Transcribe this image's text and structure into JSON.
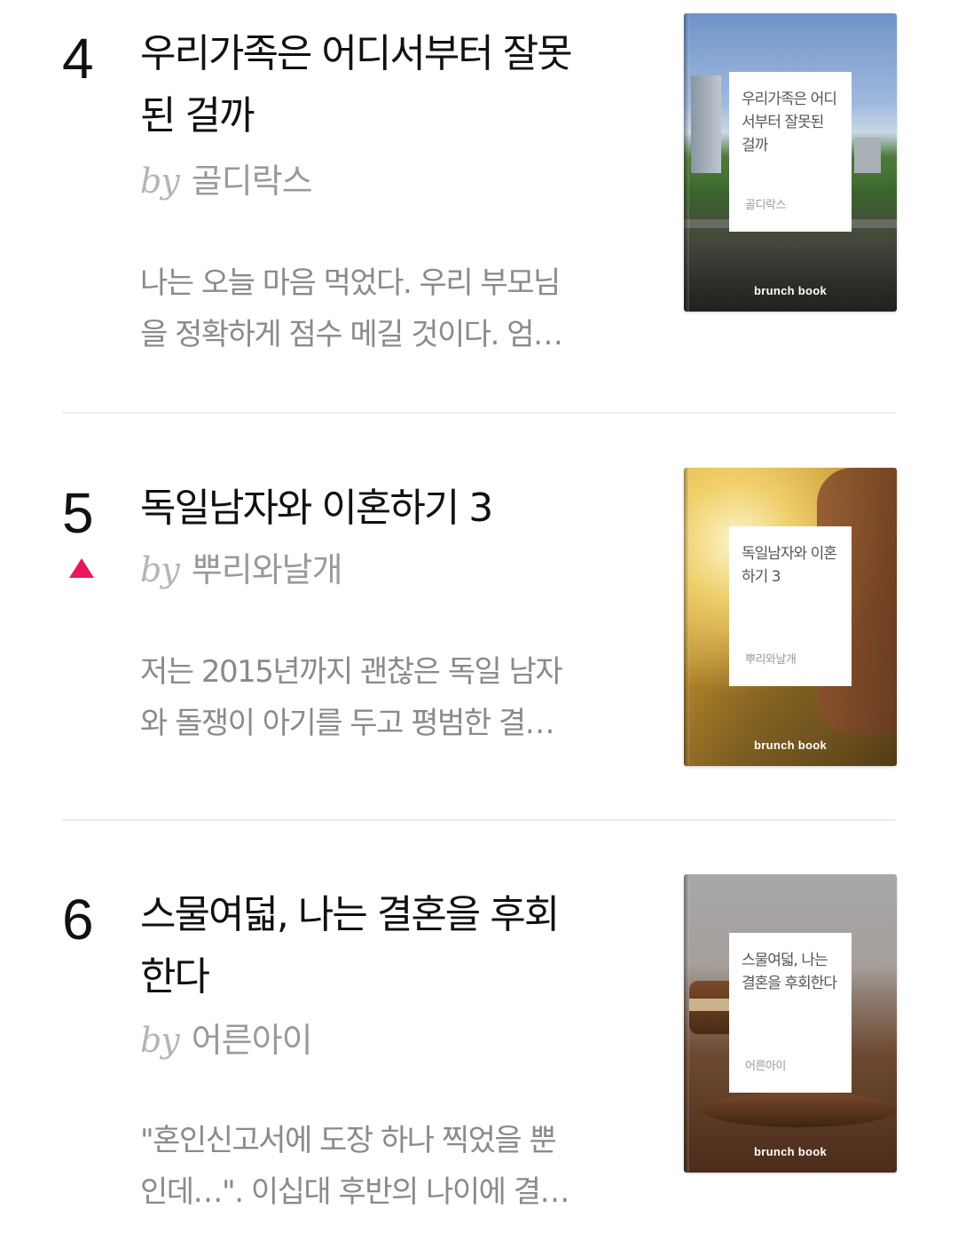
{
  "items": [
    {
      "rank": "4",
      "title_line1": "우리가족은 어디서부터 잘못",
      "title_line2": "된 걸까",
      "by": "by",
      "author": "골디락스",
      "excerpt_line1": "나는 오늘 마음 먹었다. 우리 부모님",
      "excerpt_line2": "을 정확하게 점수 메길 것이다. 엄…",
      "cover_title": "우리가족은 어디서부터 잘못된 걸까",
      "cover_author": "골디락스",
      "brand": "brunch book"
    },
    {
      "rank": "5",
      "rank_change": "up",
      "title_line1": "독일남자와 이혼하기 3",
      "by": "by",
      "author": "뿌리와날개",
      "excerpt_line1": "저는 2015년까지 괜찮은 독일 남자",
      "excerpt_line2": "와 돌쟁이 아기를 두고 평범한 결…",
      "cover_title": "독일남자와 이혼하기 3",
      "cover_author": "뿌리와날개",
      "brand": "brunch book"
    },
    {
      "rank": "6",
      "title_line1": "스물여덟, 나는 결혼을 후회",
      "title_line2": "한다",
      "by": "by",
      "author": "어른아이",
      "excerpt_line1": "\"혼인신고서에 도장 하나 찍었을 뿐",
      "excerpt_line2": "인데…\". 이십대 후반의 나이에 결…",
      "cover_title": "스물여덟, 나는 결혼을 후회한다",
      "cover_author": "어른아이",
      "brand": "brunch book"
    }
  ],
  "colors": {
    "rank_up": "#e8175d",
    "title": "#111111",
    "byline": "#9a9a9a",
    "excerpt": "#8a8a8a",
    "divider": "#ececec"
  }
}
